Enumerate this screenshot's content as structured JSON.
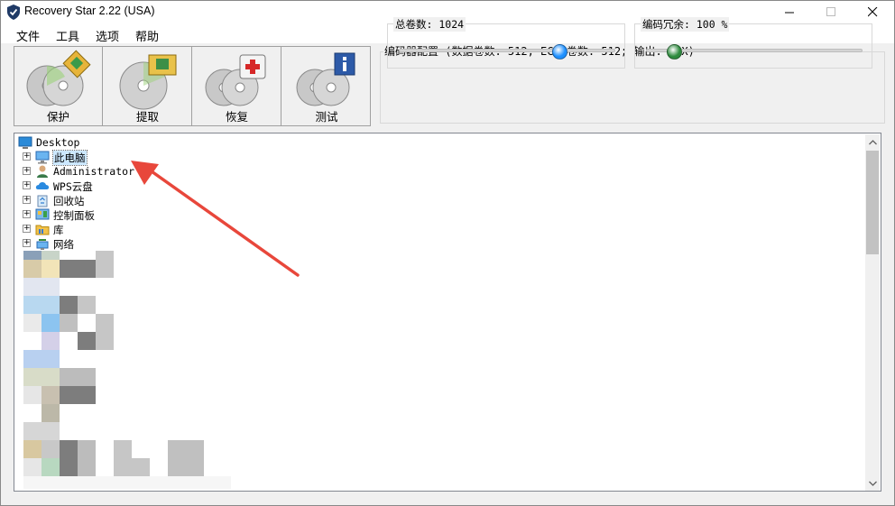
{
  "window": {
    "title": "Recovery Star 2.22 (USA)",
    "icon": "shield-check-icon"
  },
  "menu": {
    "items": [
      "文件",
      "工具",
      "选项",
      "帮助"
    ]
  },
  "toolbar": {
    "buttons": [
      {
        "label": "保护",
        "icon": "discs-protect-icon"
      },
      {
        "label": "提取",
        "icon": "disc-extract-icon"
      },
      {
        "label": "恢复",
        "icon": "discs-firstaid-icon"
      },
      {
        "label": "测试",
        "icon": "discs-info-icon"
      }
    ]
  },
  "encoder": {
    "title": "编码器配置 (数据卷数: 512; ECC 卷数: 512; 输出: 2 X)",
    "total_volumes_label": "总卷数: 1024",
    "total_volumes_fraction": 0.74,
    "redundancy_label": "编码冗余: 100 %",
    "redundancy_fraction": 0.12,
    "thumb_colors": {
      "total": "#1e90ff",
      "redundancy": "#2e8b3e"
    }
  },
  "tree": {
    "root": "Desktop",
    "items": [
      {
        "label": "此电脑",
        "icon": "computer-icon",
        "selected": true
      },
      {
        "label": "Administrator",
        "icon": "user-icon",
        "selected": false
      },
      {
        "label": "WPS云盘",
        "icon": "cloud-icon",
        "selected": false
      },
      {
        "label": "回收站",
        "icon": "recycle-bin-icon",
        "selected": false
      },
      {
        "label": "控制面板",
        "icon": "control-panel-icon",
        "selected": false
      },
      {
        "label": "库",
        "icon": "library-folder-icon",
        "selected": false
      },
      {
        "label": "网络",
        "icon": "network-icon",
        "selected": false
      }
    ]
  },
  "colors": {
    "accent_arrow": "#e8473b",
    "selection": "#cce8ff"
  }
}
